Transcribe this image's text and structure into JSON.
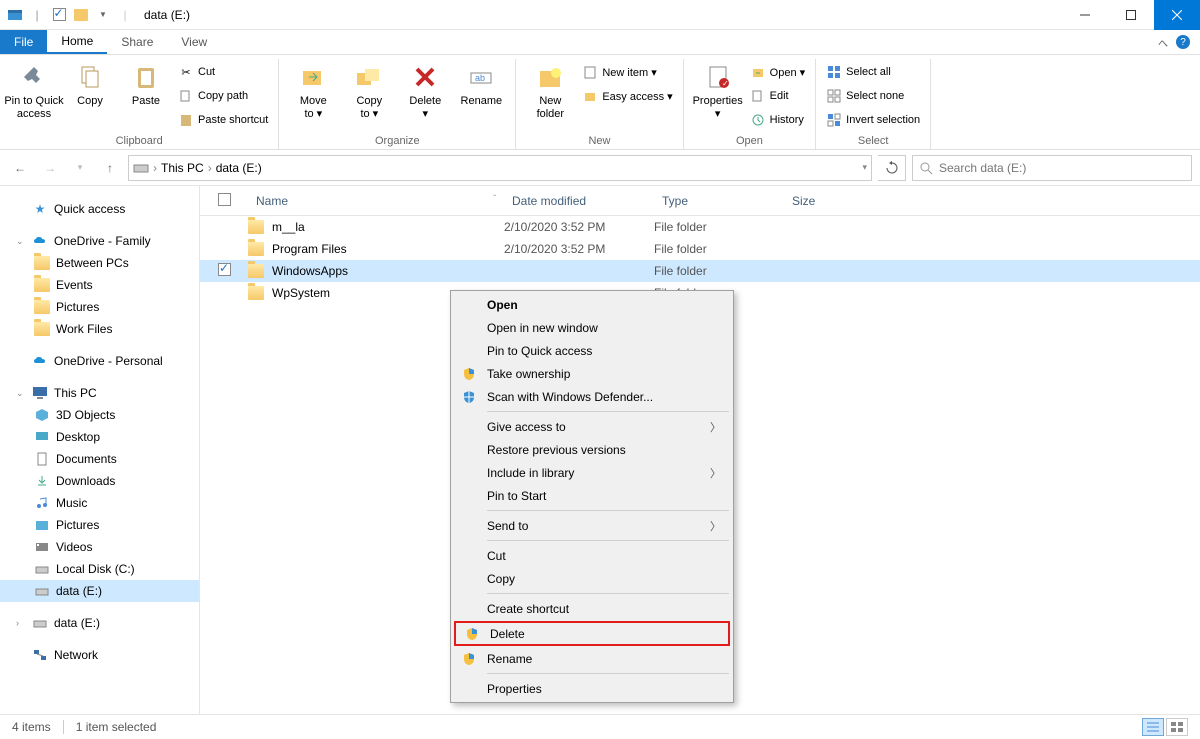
{
  "window": {
    "title": "data (E:)"
  },
  "menubar": {
    "file": "File",
    "tabs": [
      "Home",
      "Share",
      "View"
    ],
    "active": 0
  },
  "ribbon": {
    "clipboard": {
      "label": "Clipboard",
      "pin": "Pin to Quick\naccess",
      "copy": "Copy",
      "paste": "Paste",
      "cut": "Cut",
      "copypath": "Copy path",
      "pasteshort": "Paste shortcut"
    },
    "organize": {
      "label": "Organize",
      "moveto": "Move\nto ▾",
      "copyto": "Copy\nto ▾",
      "delete": "Delete\n▾",
      "rename": "Rename"
    },
    "new": {
      "label": "New",
      "newfolder": "New\nfolder",
      "newitem": "New item ▾",
      "easyaccess": "Easy access ▾"
    },
    "open": {
      "label": "Open",
      "properties": "Properties\n▾",
      "open": "Open ▾",
      "edit": "Edit",
      "history": "History"
    },
    "select": {
      "label": "Select",
      "selectall": "Select all",
      "selectnone": "Select none",
      "invert": "Invert selection"
    }
  },
  "nav": {
    "thispc": "This PC",
    "location": "data (E:)",
    "searchplaceholder": "Search data (E:)"
  },
  "tree": {
    "quickaccess": "Quick access",
    "onedrive_family": "OneDrive - Family",
    "between": "Between PCs",
    "events": "Events",
    "pictures": "Pictures",
    "workfiles": "Work Files",
    "onedrive_personal": "OneDrive - Personal",
    "thispc": "This PC",
    "objects3d": "3D Objects",
    "desktop": "Desktop",
    "documents": "Documents",
    "downloads": "Downloads",
    "music": "Music",
    "pictures2": "Pictures",
    "videos": "Videos",
    "localc": "Local Disk (C:)",
    "datae": "data (E:)",
    "datae2": "data (E:)",
    "network": "Network"
  },
  "columns": {
    "name": "Name",
    "date": "Date modified",
    "type": "Type",
    "size": "Size"
  },
  "rows": [
    {
      "name": "m__la",
      "date": "2/10/2020 3:52 PM",
      "type": "File folder"
    },
    {
      "name": "Program Files",
      "date": "2/10/2020 3:52 PM",
      "type": "File folder"
    },
    {
      "name": "WindowsApps",
      "date": "",
      "type": "File folder",
      "selected": true
    },
    {
      "name": "WpSystem",
      "date": "",
      "type": "File folder"
    }
  ],
  "ctx": {
    "open": "Open",
    "openwin": "Open in new window",
    "pinquick": "Pin to Quick access",
    "takeown": "Take ownership",
    "defender": "Scan with Windows Defender...",
    "giveaccess": "Give access to",
    "restore": "Restore previous versions",
    "includelib": "Include in library",
    "pinstart": "Pin to Start",
    "sendto": "Send to",
    "cut": "Cut",
    "copy": "Copy",
    "shortcut": "Create shortcut",
    "delete": "Delete",
    "rename": "Rename",
    "properties": "Properties"
  },
  "status": {
    "items": "4 items",
    "selected": "1 item selected"
  }
}
